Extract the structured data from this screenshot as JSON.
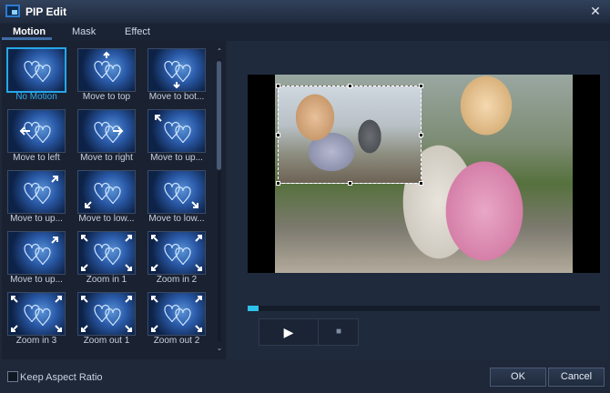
{
  "window": {
    "title": "PIP Edit"
  },
  "tabs": [
    {
      "label": "Motion",
      "active": true
    },
    {
      "label": "Mask",
      "active": false
    },
    {
      "label": "Effect",
      "active": false
    }
  ],
  "motions": [
    {
      "label": "No Motion",
      "selected": true,
      "arrow": "none"
    },
    {
      "label": "Move to top",
      "arrow": "up"
    },
    {
      "label": "Move to bot...",
      "arrow": "down"
    },
    {
      "label": "Move to left",
      "arrow": "left"
    },
    {
      "label": "Move to right",
      "arrow": "right"
    },
    {
      "label": "Move to up...",
      "arrow": "up-left"
    },
    {
      "label": "Move to up...",
      "arrow": "up-right"
    },
    {
      "label": "Move to low...",
      "arrow": "down-left"
    },
    {
      "label": "Move to low...",
      "arrow": "down-right"
    },
    {
      "label": "Move to up...",
      "arrow": "up-right"
    },
    {
      "label": "Zoom in 1",
      "arrow": "zoom"
    },
    {
      "label": "Zoom in 2",
      "arrow": "zoom"
    },
    {
      "label": "Zoom in 3",
      "arrow": "zoom"
    },
    {
      "label": "Zoom out 1",
      "arrow": "zoom"
    },
    {
      "label": "Zoom out 2",
      "arrow": "zoom"
    }
  ],
  "player": {
    "progress": 0.03,
    "play_icon": "▶",
    "stop_icon": "■"
  },
  "footer": {
    "keep_aspect_label": "Keep Aspect Ratio",
    "keep_aspect_checked": false,
    "ok_label": "OK",
    "cancel_label": "Cancel"
  },
  "icons": {
    "close": "✕",
    "scroll_up": "⌃",
    "scroll_down": "⌄"
  }
}
